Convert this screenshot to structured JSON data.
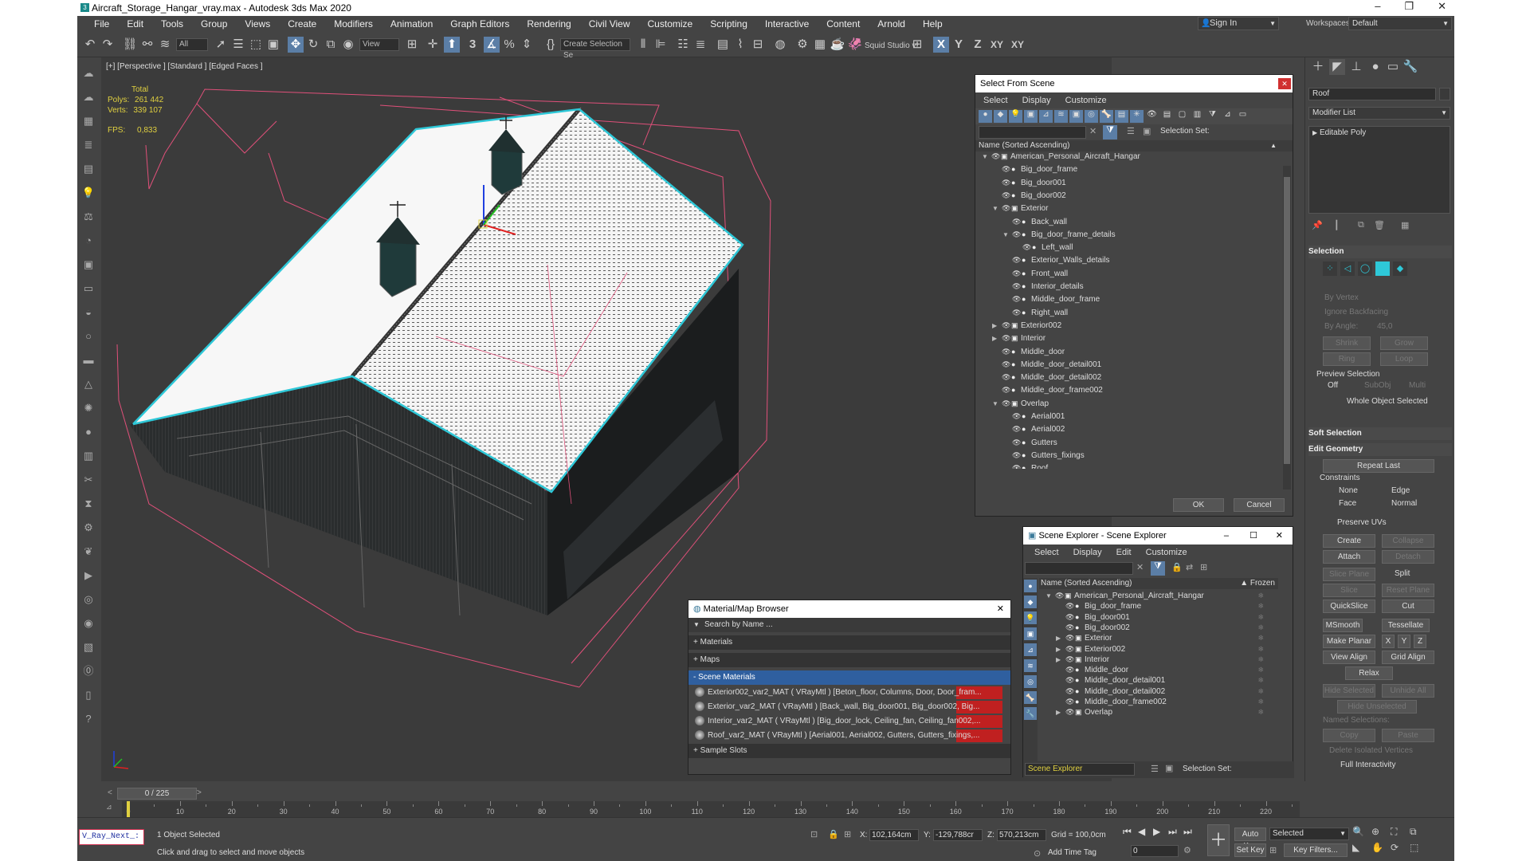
{
  "window": {
    "title": "Aircraft_Storage_Hangar_vray.max - Autodesk 3ds Max 2020",
    "app_icon": "3ds-max-icon",
    "controls": [
      "–",
      "❐",
      "✕"
    ]
  },
  "menu": [
    "File",
    "Edit",
    "Tools",
    "Group",
    "Views",
    "Create",
    "Modifiers",
    "Animation",
    "Graph Editors",
    "Rendering",
    "Civil View",
    "Customize",
    "Scripting",
    "Interactive",
    "Content",
    "Arnold",
    "Help"
  ],
  "account": {
    "signin": "Sign In",
    "workspaces_label": "Workspaces:",
    "workspace": "Default"
  },
  "toolbar": {
    "filter": "All",
    "view": "View",
    "create_selection_set": "Create Selection Se",
    "squid": "Squid Studio v",
    "angle": "3",
    "axes": [
      "X",
      "Y",
      "Z",
      "XY",
      "XY"
    ]
  },
  "viewport": {
    "label": "[+] [Perspective ] [Standard ] [Edged Faces ]",
    "stats": {
      "total_label": "Total",
      "polys_label": "Polys:",
      "polys": "261 442",
      "verts_label": "Verts:",
      "verts": "339 107",
      "fps_label": "FPS:",
      "fps": "0,833"
    }
  },
  "select_from_scene": {
    "title": "Select From Scene",
    "menu": [
      "Select",
      "Display",
      "Customize"
    ],
    "selection_set_label": "Selection Set:",
    "column": "Name (Sorted Ascending)",
    "rows": [
      {
        "name": "American_Personal_Aircraft_Hangar",
        "indent": 0,
        "toggle": "open",
        "group": true
      },
      {
        "name": "Big_door_frame",
        "indent": 1,
        "toggle": "",
        "group": false
      },
      {
        "name": "Big_door001",
        "indent": 1,
        "toggle": "",
        "group": false
      },
      {
        "name": "Big_door002",
        "indent": 1,
        "toggle": "",
        "group": false
      },
      {
        "name": "Exterior",
        "indent": 1,
        "toggle": "open",
        "group": true
      },
      {
        "name": "Back_wall",
        "indent": 2,
        "toggle": "",
        "group": false
      },
      {
        "name": "Big_door_frame_details",
        "indent": 2,
        "toggle": "open",
        "group": false
      },
      {
        "name": "Left_wall",
        "indent": 3,
        "toggle": "",
        "group": false
      },
      {
        "name": "Exterior_Walls_details",
        "indent": 2,
        "toggle": "",
        "group": false
      },
      {
        "name": "Front_wall",
        "indent": 2,
        "toggle": "",
        "group": false
      },
      {
        "name": "Interior_details",
        "indent": 2,
        "toggle": "",
        "group": false
      },
      {
        "name": "Middle_door_frame",
        "indent": 2,
        "toggle": "",
        "group": false
      },
      {
        "name": "Right_wall",
        "indent": 2,
        "toggle": "",
        "group": false
      },
      {
        "name": "Exterior002",
        "indent": 1,
        "toggle": "closed",
        "group": true
      },
      {
        "name": "Interior",
        "indent": 1,
        "toggle": "closed",
        "group": true
      },
      {
        "name": "Middle_door",
        "indent": 1,
        "toggle": "",
        "group": false
      },
      {
        "name": "Middle_door_detail001",
        "indent": 1,
        "toggle": "",
        "group": false
      },
      {
        "name": "Middle_door_detail002",
        "indent": 1,
        "toggle": "",
        "group": false
      },
      {
        "name": "Middle_door_frame002",
        "indent": 1,
        "toggle": "",
        "group": false
      },
      {
        "name": "Overlap",
        "indent": 1,
        "toggle": "open",
        "group": true
      },
      {
        "name": "Aerial001",
        "indent": 2,
        "toggle": "",
        "group": false
      },
      {
        "name": "Aerial002",
        "indent": 2,
        "toggle": "",
        "group": false
      },
      {
        "name": "Gutters",
        "indent": 2,
        "toggle": "",
        "group": false
      },
      {
        "name": "Gutters_fixings",
        "indent": 2,
        "toggle": "",
        "group": false
      },
      {
        "name": "Roof",
        "indent": 2,
        "toggle": "",
        "group": false
      }
    ],
    "ok": "OK",
    "cancel": "Cancel"
  },
  "scene_explorer": {
    "title": "Scene Explorer - Scene Explorer",
    "menu": [
      "Select",
      "Display",
      "Edit",
      "Customize"
    ],
    "column": "Name (Sorted Ascending)",
    "frozen": "▲ Frozen",
    "rows": [
      {
        "name": "American_Personal_Aircraft_Hangar",
        "indent": 0,
        "toggle": "open",
        "group": true
      },
      {
        "name": "Big_door_frame",
        "indent": 1,
        "toggle": "",
        "group": false
      },
      {
        "name": "Big_door001",
        "indent": 1,
        "toggle": "",
        "group": false
      },
      {
        "name": "Big_door002",
        "indent": 1,
        "toggle": "",
        "group": false
      },
      {
        "name": "Exterior",
        "indent": 1,
        "toggle": "closed",
        "group": true
      },
      {
        "name": "Exterior002",
        "indent": 1,
        "toggle": "closed",
        "group": true
      },
      {
        "name": "Interior",
        "indent": 1,
        "toggle": "closed",
        "group": true
      },
      {
        "name": "Middle_door",
        "indent": 1,
        "toggle": "",
        "group": false
      },
      {
        "name": "Middle_door_detail001",
        "indent": 1,
        "toggle": "",
        "group": false
      },
      {
        "name": "Middle_door_detail002",
        "indent": 1,
        "toggle": "",
        "group": false
      },
      {
        "name": "Middle_door_frame002",
        "indent": 1,
        "toggle": "",
        "group": false
      },
      {
        "name": "Overlap",
        "indent": 1,
        "toggle": "closed",
        "group": true
      }
    ],
    "footer_name": "Scene Explorer",
    "selection_set_label": "Selection Set:"
  },
  "material_browser": {
    "title": "Material/Map Browser",
    "search_placeholder": "Search by Name ...",
    "sections": [
      "+ Materials",
      "+ Maps",
      "- Scene Materials",
      "+ Sample Slots"
    ],
    "materials": [
      "Exterior002_var2_MAT  ( VRayMtl )  [Beton_floor, Columns, Door, Door_fram...",
      "Exterior_var2_MAT  ( VRayMtl )  [Back_wall, Big_door001, Big_door002, Big...",
      "Interior_var2_MAT  ( VRayMtl )  [Big_door_lock, Ceiling_fan, Ceiling_fan002,...",
      "Roof_var2_MAT  ( VRayMtl )  [Aerial001, Aerial002, Gutters, Gutters_fixings,..."
    ]
  },
  "command_panel": {
    "object_name": "Roof",
    "modifier_list": "Modifier List",
    "stack_item": "Editable Poly",
    "selection": {
      "header": "Selection",
      "by_vertex": "By Vertex",
      "ignore_backfacing": "Ignore Backfacing",
      "by_angle": "By Angle:",
      "angle": "45,0",
      "shrink": "Shrink",
      "grow": "Grow",
      "ring": "Ring",
      "loop": "Loop",
      "preview_label": "Preview Selection",
      "off": "Off",
      "subobj": "SubObj",
      "multi": "Multi",
      "whole": "Whole Object Selected"
    },
    "soft_selection": "Soft Selection",
    "edit_geometry": {
      "header": "Edit Geometry",
      "repeat_last": "Repeat Last",
      "constraints": "Constraints",
      "none": "None",
      "edge": "Edge",
      "face": "Face",
      "normal": "Normal",
      "preserve_uvs": "Preserve UVs",
      "create": "Create",
      "collapse": "Collapse",
      "attach": "Attach",
      "detach": "Detach",
      "slice_plane": "Slice Plane",
      "split": "Split",
      "slice": "Slice",
      "reset_plane": "Reset Plane",
      "quickslice": "QuickSlice",
      "cut": "Cut",
      "msmooth": "MSmooth",
      "tessellate": "Tessellate",
      "make_planar": "Make Planar",
      "x": "X",
      "y": "Y",
      "z": "Z",
      "view_align": "View Align",
      "grid_align": "Grid Align",
      "relax": "Relax",
      "hide_selected": "Hide Selected",
      "unhide_all": "Unhide All",
      "hide_unselected": "Hide Unselected",
      "named_selections": "Named Selections:",
      "copy": "Copy",
      "paste": "Paste",
      "delete_isolated": "Delete Isolated Vertices",
      "full_interactivity": "Full Interactivity"
    }
  },
  "timeline": {
    "frame": "0 / 225",
    "ticks": [
      "0",
      "10",
      "20",
      "30",
      "40",
      "50",
      "60",
      "70",
      "80",
      "90",
      "100",
      "110",
      "120",
      "130",
      "140",
      "150",
      "160",
      "170",
      "180",
      "190",
      "200",
      "210",
      "220"
    ]
  },
  "status": {
    "script": "V_Ray_Next_:",
    "selected": "1 Object Selected",
    "prompt": "Click and drag to select and move objects",
    "x_label": "X:",
    "x": "102,164cm",
    "y_label": "Y:",
    "y": "-129,788cr",
    "z_label": "Z:",
    "z": "570,213cm",
    "grid": "Grid = 100,0cm",
    "add_time_tag": "Add Time Tag",
    "auto_key": "Auto Key",
    "set_key": "Set Key",
    "selected_dd": "Selected",
    "key_filters": "Key Filters...",
    "frame_value": "0"
  },
  "colors": {
    "selection_cyan": "#2ec8d8",
    "bbox_pink": "#e0507a",
    "dialog_blue": "#5b7ea6",
    "material_red": "#c02020"
  }
}
